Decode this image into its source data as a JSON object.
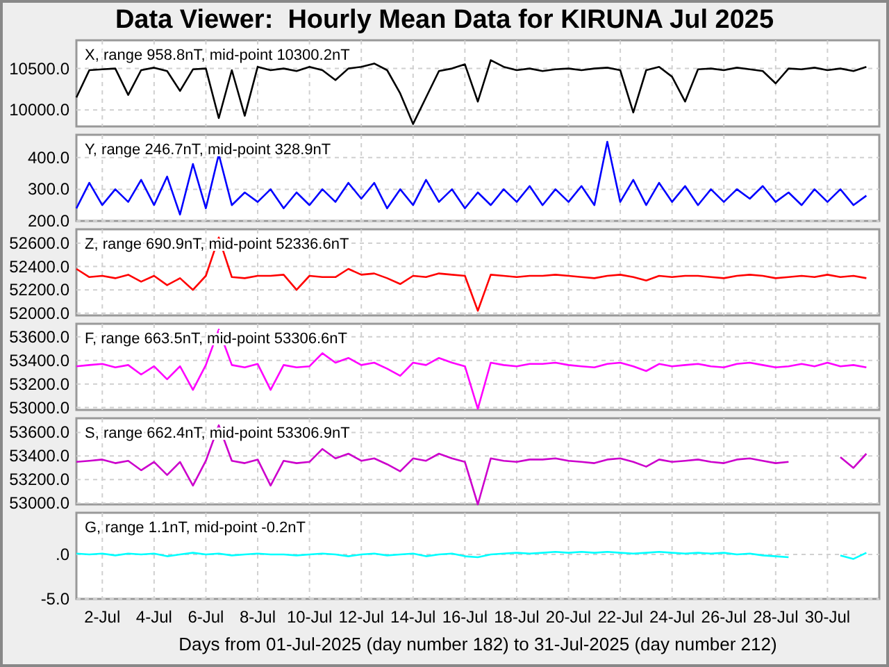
{
  "title": "Data Viewer:  Hourly Mean Data for KIRUNA Jul 2025",
  "panels": [
    {
      "label": "X, range 958.8nT, mid-point 10300.2nT",
      "chart_data": {
        "type": "line",
        "grid": true,
        "ylim": [
          9800,
          10840
        ],
        "yticks": [
          {
            "value": 10000,
            "label": "10000.0"
          },
          {
            "value": 10500,
            "label": "10500.0"
          }
        ],
        "series": [
          {
            "color": "#000000",
            "values": [
              10150,
              10480,
              10490,
              10500,
              10180,
              10480,
              10510,
              10470,
              10230,
              10490,
              10500,
              9900,
              10480,
              9930,
              10520,
              10480,
              10500,
              10470,
              10520,
              10480,
              10360,
              10500,
              10520,
              10560,
              10480,
              10200,
              9830,
              10150,
              10470,
              10500,
              10550,
              10100,
              10600,
              10520,
              10480,
              10500,
              10470,
              10490,
              10500,
              10480,
              10500,
              10510,
              10480,
              9970,
              10480,
              10520,
              10400,
              10100,
              10490,
              10500,
              10480,
              10510,
              10490,
              10470,
              10320,
              10500,
              10490,
              10510,
              10480,
              10500,
              10470,
              10520
            ]
          }
        ]
      }
    },
    {
      "label": "Y, range 246.7nT, mid-point 328.9nT",
      "chart_data": {
        "type": "line",
        "grid": true,
        "ylim": [
          200,
          472
        ],
        "yticks": [
          {
            "value": 200,
            "label": "200.0"
          },
          {
            "value": 300,
            "label": "300.0"
          },
          {
            "value": 400,
            "label": "400.0"
          }
        ],
        "series": [
          {
            "color": "#0000ff",
            "values": [
              240,
              320,
              250,
              300,
              260,
              330,
              250,
              340,
              220,
              380,
              240,
              410,
              250,
              290,
              260,
              300,
              240,
              290,
              250,
              300,
              260,
              320,
              270,
              320,
              240,
              300,
              250,
              330,
              260,
              300,
              240,
              290,
              250,
              300,
              260,
              310,
              250,
              300,
              260,
              310,
              250,
              450,
              260,
              330,
              250,
              320,
              260,
              310,
              250,
              300,
              260,
              300,
              270,
              310,
              260,
              290,
              250,
              300,
              260,
              300,
              250,
              280
            ]
          }
        ]
      }
    },
    {
      "label": "Z, range 690.9nT, mid-point 52336.6nT",
      "chart_data": {
        "type": "line",
        "grid": true,
        "ylim": [
          51980,
          52720
        ],
        "yticks": [
          {
            "value": 52000,
            "label": "52000.0"
          },
          {
            "value": 52200,
            "label": "52200.0"
          },
          {
            "value": 52400,
            "label": "52400.0"
          },
          {
            "value": 52600,
            "label": "52600.0"
          }
        ],
        "series": [
          {
            "color": "#ff0000",
            "values": [
              52380,
              52310,
              52320,
              52300,
              52330,
              52270,
              52320,
              52240,
              52300,
              52200,
              52320,
              52650,
              52310,
              52300,
              52320,
              52320,
              52330,
              52200,
              52320,
              52310,
              52310,
              52380,
              52330,
              52340,
              52300,
              52250,
              52320,
              52310,
              52340,
              52330,
              52320,
              52020,
              52330,
              52320,
              52310,
              52320,
              52320,
              52330,
              52320,
              52310,
              52300,
              52320,
              52330,
              52310,
              52280,
              52320,
              52310,
              52320,
              52320,
              52310,
              52300,
              52320,
              52330,
              52320,
              52300,
              52310,
              52320,
              52310,
              52330,
              52310,
              52320,
              52300
            ]
          }
        ]
      }
    },
    {
      "label": "F, range 663.5nT, mid-point 53306.6nT",
      "chart_data": {
        "type": "line",
        "grid": true,
        "ylim": [
          52980,
          53710
        ],
        "yticks": [
          {
            "value": 53000,
            "label": "53000.0"
          },
          {
            "value": 53200,
            "label": "53200.0"
          },
          {
            "value": 53400,
            "label": "53400.0"
          },
          {
            "value": 53600,
            "label": "53600.0"
          }
        ],
        "series": [
          {
            "color": "#ff00ff",
            "values": [
              53350,
              53360,
              53370,
              53340,
              53360,
              53280,
              53350,
              53240,
              53350,
              53150,
              53360,
              53660,
              53360,
              53340,
              53370,
              53150,
              53360,
              53340,
              53350,
              53460,
              53380,
              53420,
              53360,
              53380,
              53330,
              53270,
              53380,
              53360,
              53420,
              53380,
              53350,
              52990,
              53380,
              53360,
              53350,
              53370,
              53370,
              53380,
              53360,
              53350,
              53340,
              53370,
              53380,
              53350,
              53310,
              53370,
              53350,
              53360,
              53370,
              53350,
              53340,
              53370,
              53380,
              53360,
              53340,
              53350,
              53370,
              53350,
              53380,
              53350,
              53360,
              53340
            ]
          }
        ]
      }
    },
    {
      "label": "S, range 662.4nT, mid-point 53306.9nT",
      "chart_data": {
        "type": "line",
        "grid": true,
        "ylim": [
          52990,
          53720
        ],
        "yticks": [
          {
            "value": 53000,
            "label": "53000.0"
          },
          {
            "value": 53200,
            "label": "53200.0"
          },
          {
            "value": 53400,
            "label": "53400.0"
          },
          {
            "value": 53600,
            "label": "53600.0"
          }
        ],
        "series": [
          {
            "color": "#cc00cc",
            "values": [
              53350,
              53360,
              53370,
              53340,
              53360,
              53280,
              53350,
              53240,
              53350,
              53150,
              53360,
              53660,
              53360,
              53340,
              53370,
              53150,
              53360,
              53340,
              53350,
              53460,
              53380,
              53420,
              53360,
              53380,
              53330,
              53270,
              53380,
              53360,
              53420,
              53380,
              53350,
              52990,
              53380,
              53360,
              53350,
              53370,
              53370,
              53380,
              53360,
              53350,
              53340,
              53370,
              53380,
              53350,
              53310,
              53370,
              53350,
              53360,
              53370,
              53350,
              53340,
              53370,
              53380,
              53360,
              53340,
              53350,
              null,
              null,
              null,
              53390,
              53300,
              53420
            ]
          }
        ]
      }
    },
    {
      "label": "G, range 1.1nT, mid-point -0.2nT",
      "chart_data": {
        "type": "line",
        "grid": true,
        "xlabel": "Days from 01-Jul-2025 (day number 182) to 31-Jul-2025 (day number 212)",
        "ylim": [
          -5,
          4.7
        ],
        "yticks": [
          {
            "value": -5,
            "label": "-5.0"
          },
          {
            "value": 0,
            "label": ".0"
          }
        ],
        "categories": [
          null,
          null,
          "2-Jul",
          null,
          null,
          null,
          "4-Jul",
          null,
          null,
          null,
          "6-Jul",
          null,
          null,
          null,
          "8-Jul",
          null,
          null,
          null,
          "10-Jul",
          null,
          null,
          null,
          "12-Jul",
          null,
          null,
          null,
          "14-Jul",
          null,
          null,
          null,
          "16-Jul",
          null,
          null,
          null,
          "18-Jul",
          null,
          null,
          null,
          "20-Jul",
          null,
          null,
          null,
          "22-Jul",
          null,
          null,
          null,
          "24-Jul",
          null,
          null,
          null,
          "26-Jul",
          null,
          null,
          null,
          "28-Jul",
          null,
          null,
          null,
          "30-Jul",
          null,
          null,
          null
        ],
        "series": [
          {
            "color": "#00ffff",
            "values": [
              0.1,
              0,
              0.1,
              -0.1,
              0.1,
              0,
              0.1,
              -0.2,
              0,
              0.2,
              0,
              0.1,
              -0.1,
              0,
              0.1,
              0,
              0,
              -0.1,
              0,
              0.1,
              0,
              -0.2,
              0,
              0.1,
              -0.1,
              0,
              0.1,
              -0.2,
              0,
              0.1,
              -0.2,
              -0.3,
              0,
              0.1,
              0.2,
              0.1,
              0.2,
              0.3,
              0.2,
              0.3,
              0.2,
              0.3,
              0.2,
              0.1,
              0.2,
              0.3,
              0.2,
              0.1,
              0.2,
              0.1,
              0.2,
              0,
              0.1,
              -0.1,
              -0.2,
              -0.3,
              null,
              null,
              null,
              -0.1,
              -0.5,
              0.2
            ]
          }
        ]
      }
    }
  ]
}
